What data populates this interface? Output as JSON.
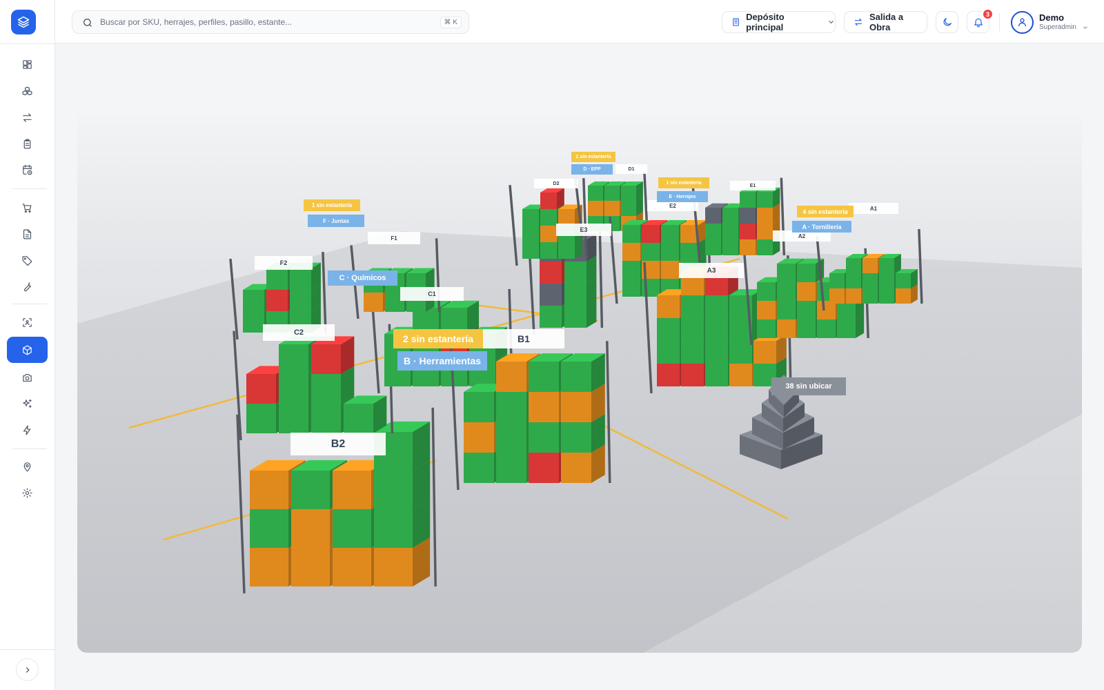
{
  "app": {
    "logo_icon": "layers-icon",
    "accent": "#2563eb"
  },
  "sidebar": {
    "items": [
      {
        "id": "dashboard",
        "icon": "grid-icon"
      },
      {
        "id": "products",
        "icon": "boxes-icon"
      },
      {
        "id": "movements",
        "icon": "arrows-icon"
      },
      {
        "id": "checklist",
        "icon": "clipboard-icon"
      },
      {
        "id": "history",
        "icon": "calendar-clock-icon"
      },
      {
        "id": "purchases",
        "icon": "cart-icon"
      },
      {
        "id": "documents",
        "icon": "file-icon"
      },
      {
        "id": "tags",
        "icon": "tag-icon"
      },
      {
        "id": "tools",
        "icon": "wrench-icon"
      },
      {
        "id": "scanner",
        "icon": "scan-icon"
      },
      {
        "id": "warehouse-3d",
        "icon": "cube-icon",
        "active": true
      },
      {
        "id": "camera",
        "icon": "camera-icon"
      },
      {
        "id": "ai",
        "icon": "sparkles-icon"
      },
      {
        "id": "automation",
        "icon": "zap-icon"
      },
      {
        "id": "locations",
        "icon": "map-pin-icon"
      },
      {
        "id": "settings",
        "icon": "settings-icon"
      }
    ],
    "expand_icon": "chevron-right-icon"
  },
  "topbar": {
    "search_placeholder": "Buscar por SKU, herrajes, perfiles, pasillo, estante...",
    "search_shortcut": "⌘ K",
    "warehouse_selector": "Depósito principal",
    "action_button": "Salida a Obra",
    "theme_icon": "moon-icon",
    "notifications_count": "3",
    "user": {
      "name": "Demo",
      "role": "Superadmin"
    }
  },
  "colors": {
    "ok": "#2faa4a",
    "low": "#e08a1e",
    "critical": "#d93636",
    "empty": "#5d6470",
    "rack": "#565b63",
    "aisle": "#f2b93b",
    "warning": "#f5c542",
    "zone": "#7ab3e8"
  },
  "scene": {
    "racks": [
      {
        "label": "A1"
      },
      {
        "label": "A2"
      },
      {
        "label": "A3"
      },
      {
        "label": "B1"
      },
      {
        "label": "B2"
      },
      {
        "label": "C1"
      },
      {
        "label": "C2"
      },
      {
        "label": "D1"
      },
      {
        "label": "D2"
      },
      {
        "label": "E1"
      },
      {
        "label": "E2"
      },
      {
        "label": "E3"
      },
      {
        "label": "F1"
      },
      {
        "label": "F2"
      }
    ],
    "zones": [
      {
        "name": "A · Tornillería",
        "warning": "4 sin estantería"
      },
      {
        "name": "B · Herramientas",
        "warning": "2 sin estantería"
      },
      {
        "name": "C · Químicos",
        "warning": ""
      },
      {
        "name": "D · EPP",
        "warning": "1 sin estantería"
      },
      {
        "name": "E · Herrajes",
        "warning": "1 sin estantería"
      },
      {
        "name": "F · Juntas",
        "warning": "1 sin estantería"
      }
    ],
    "unplaced": "38 sin ubicar"
  }
}
